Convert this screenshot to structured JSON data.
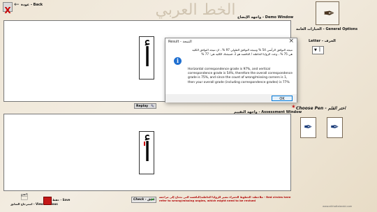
{
  "topbar": {
    "close_glyph": "X",
    "back_label": "عودة - Back"
  },
  "banner": {
    "text": "الخط العربي"
  },
  "demo": {
    "label": "واجهة الإيضاح - Demo Window",
    "glyph": "أ"
  },
  "general_options": {
    "label": "الخيارات العامة - General Options"
  },
  "letter": {
    "label": "Letter - الحرف",
    "value": "أ"
  },
  "dialog": {
    "title": "Result - النتيجة",
    "close_glyph": "×",
    "info_glyph": "i",
    "arabic_text": "نتيجة التوافق الرأسي 54 % ونتيجة التوافق الطولي 97 % ، ان نتيجة التوافق الكلية هي 75 % ، وعدد الزوايا الخاطئة / الناقصة هو 1، فنتيجتك الكلية هي: 77 %",
    "english_text": "Horizontal correspondence grade is 97%, and vertical correspondence grade is 54%, therefore the overall correspondence grade is 75%, and since the count of wrong/missing corners is 1, then your overall grade (including correspondence grades) is 77%",
    "ok_label": "OK"
  },
  "replay": {
    "label": "Replay"
  },
  "assessment": {
    "label": "واجهة التقييم - Assessment Window",
    "glyph": "أ"
  },
  "choose_pen": {
    "label": "Choose Pen - اختر القلم",
    "star": "*"
  },
  "bottom": {
    "previous_label": "استرجاع السابق - View Previous",
    "save_label": "حفظ - Save",
    "check_label": "Check - تحقق",
    "hint": "ملاحظة: الخطوط الحمراء تشير للزوايا الخاطئة/الناقصة التي تحتاج إلى مراجعة - Red circles here refer to wrong/missing angles, which might need to be revised",
    "footer": "www.alkhattalarabi.com"
  }
}
